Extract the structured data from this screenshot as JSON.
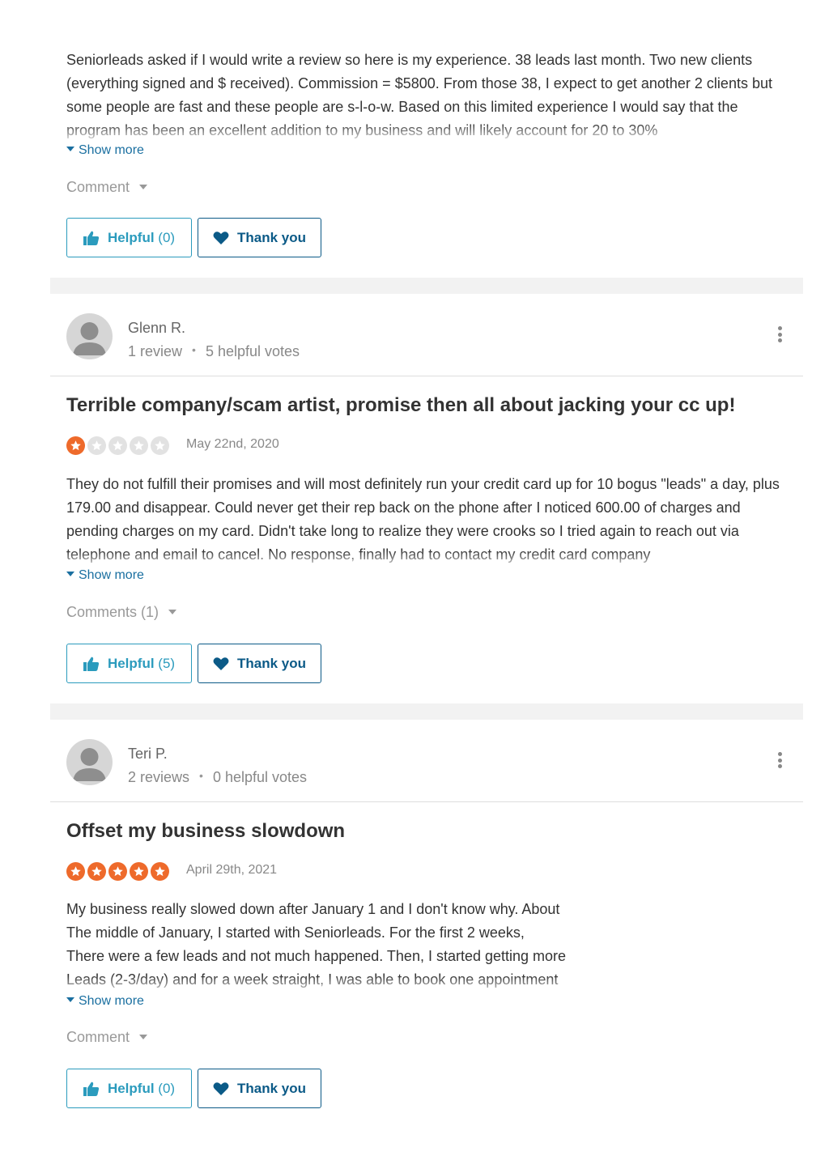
{
  "reviews": [
    {
      "body": "Seniorleads asked if I would write a review so here is my experience. 38 leads last month. Two new clients (everything signed and $ received). Commission = $5800. From those 38, I expect to get another 2 clients but some people are fast and these people are s-l-o-w. Based on this limited experience I would say that the program has been an excellent addition to my business and will likely account for 20 to 30%",
      "show_more": "Show more",
      "comment_label": "Comment",
      "helpful_label": "Helpful",
      "helpful_count": "(0)",
      "thank_label": "Thank you"
    },
    {
      "reviewer_name": "Glenn R.",
      "review_count": "1 review",
      "helpful_votes": "5 helpful votes",
      "title": "Terrible company/scam artist, promise then all about jacking your cc up!",
      "rating": 1,
      "rating_max": 5,
      "date": "May 22nd, 2020",
      "body": "They do not fulfill their promises and will most definitely run your credit card up for 10 bogus \"leads\" a day, plus 179.00 and disappear. Could never get their rep back on the phone after I noticed 600.00 of charges and pending charges on my card. Didn't take long to realize they were crooks so I tried again to reach out via telephone and email to cancel. No response, finally had to contact my credit card company",
      "show_more": "Show more",
      "comment_label": "Comments (1)",
      "helpful_label": "Helpful",
      "helpful_count": "(5)",
      "thank_label": "Thank you"
    },
    {
      "reviewer_name": "Teri P.",
      "review_count": "2 reviews",
      "helpful_votes": "0 helpful votes",
      "title": "Offset my business slowdown",
      "rating": 5,
      "rating_max": 5,
      "date": "April 29th, 2021",
      "body_lines": [
        "My business really slowed down after January 1 and I don't know why. About",
        "The middle of January, I started with Seniorleads. For the first 2 weeks,",
        "There were a few leads and not much happened. Then, I started getting more",
        "Leads (2-3/day) and for a week straight, I was able to book one appointment"
      ],
      "show_more": "Show more",
      "comment_label": "Comment",
      "helpful_label": "Helpful",
      "helpful_count": "(0)",
      "thank_label": "Thank you"
    }
  ],
  "colors": {
    "star_on": "#ee6a2b",
    "star_off": "#e2e2e2",
    "helpful": "#2b9bbd",
    "thank": "#0b5a87",
    "link": "#1a6fa0"
  },
  "icons": {
    "thumbs_up": "thumbs-up-icon",
    "heart": "heart-icon",
    "star": "star-icon",
    "kebab": "more-options-icon",
    "caret": "caret-down-icon",
    "avatar": "user-avatar-icon"
  }
}
